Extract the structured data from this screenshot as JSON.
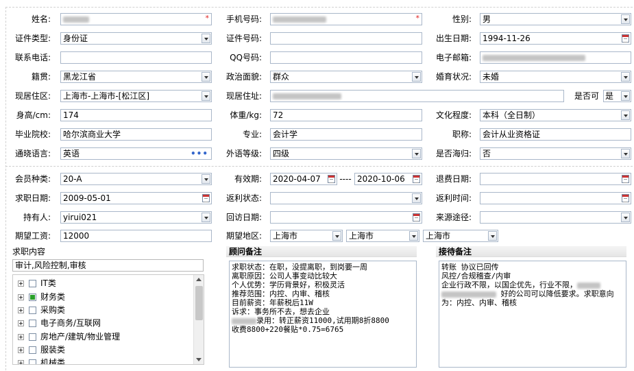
{
  "profile": {
    "name": {
      "label": "姓名:",
      "value": "",
      "required": "*"
    },
    "phone": {
      "label": "手机号码:",
      "value": "",
      "required": "*"
    },
    "gender": {
      "label": "性别:",
      "value": "男"
    },
    "id_type": {
      "label": "证件类型:",
      "value": "身份证"
    },
    "id_number": {
      "label": "证件号码:",
      "value": ""
    },
    "birth_date": {
      "label": "出生日期:",
      "value": "1994-11-26"
    },
    "contact_phone": {
      "label": "联系电话:",
      "value": ""
    },
    "qq": {
      "label": "QQ号码:",
      "value": ""
    },
    "email": {
      "label": "电子邮箱:",
      "value": ""
    },
    "native_place": {
      "label": "籍贯:",
      "value": "黑龙江省"
    },
    "political_status": {
      "label": "政治面貌:",
      "value": "群众"
    },
    "marital_status": {
      "label": "婚育状况:",
      "value": "未婚"
    },
    "current_area": {
      "label": "现居住区:",
      "value": "上海市-上海市-[松江区]"
    },
    "current_address": {
      "label": "现居住址:",
      "value": ""
    },
    "can_label": {
      "label": "是否可",
      "value": "是"
    },
    "height": {
      "label": "身高/cm:",
      "value": "174"
    },
    "weight": {
      "label": "体重/kg:",
      "value": "72"
    },
    "education": {
      "label": "文化程度:",
      "value": "本科（全日制）"
    },
    "school": {
      "label": "毕业院校:",
      "value": "哈尔滨商业大学"
    },
    "major": {
      "label": "专业:",
      "value": "会计学"
    },
    "title": {
      "label": "职称:",
      "value": "会计从业资格证"
    },
    "language": {
      "label": "通晓语言:",
      "value": "英语"
    },
    "foreign_level": {
      "label": "外语等级:",
      "value": "四级"
    },
    "returnee": {
      "label": "是否海归:",
      "value": "否"
    }
  },
  "membership": {
    "member_type": {
      "label": "会员种类:",
      "value": "20-A"
    },
    "validity": {
      "label": "有效期:",
      "start": "2020-04-07",
      "separator": "----",
      "end": "2020-10-06"
    },
    "refund_date": {
      "label": "退费日期:",
      "value": ""
    },
    "job_seek_date": {
      "label": "求职日期:",
      "value": "2009-05-01"
    },
    "rebate_status": {
      "label": "返利状态:",
      "value": ""
    },
    "rebate_time": {
      "label": "返利时间:",
      "value": ""
    },
    "holder": {
      "label": "持有人:",
      "value": "yirui021"
    },
    "revisit_date": {
      "label": "回访日期:",
      "value": ""
    },
    "source": {
      "label": "来源途径:",
      "value": ""
    },
    "expected_salary": {
      "label": "期望工资:",
      "value": "12000"
    },
    "expected_area": {
      "label": "期望地区:",
      "values": [
        "上海市",
        "上海市",
        "上海市"
      ]
    }
  },
  "job_content": {
    "title": "求职内容",
    "value": "审计,风险控制,审核",
    "tree": [
      {
        "label": "IT类",
        "checked": false
      },
      {
        "label": "财务类",
        "checked": true
      },
      {
        "label": "采购类",
        "checked": false
      },
      {
        "label": "电子商务/互联网",
        "checked": false
      },
      {
        "label": "房地产/建筑/物业管理",
        "checked": false
      },
      {
        "label": "服装类",
        "checked": false
      },
      {
        "label": "机械类",
        "checked": false
      }
    ]
  },
  "consultant_notes": {
    "title": "顾问备注",
    "lines": [
      "求职状态：在职，没提离职，到岗要一周",
      "离职原因：公司人事变动比较大",
      "个人优势：学历背景好，积极灵活",
      "推荐范围：内控、内审、稽核",
      "目前薪资：年薪税后11W",
      "诉求：事务所不去，想去企业",
      "录用：转正薪资11000,试用期8折8800",
      "收费8800+220餐贴*0.75=6765"
    ]
  },
  "reception_notes": {
    "title": "接待备注",
    "lines": [
      "转账 协议已回传",
      "风控/合规稽查/内审",
      "企业行政不限，以国企优先，行业不限，",
      "好的公司可以降低要求。求职意向",
      "为：内控、内审、稽核"
    ]
  },
  "icons": {
    "dropdown": "chevron-down-icon",
    "calendar": "calendar-icon",
    "more": "ellipsis-icon",
    "expand": "plus-box-icon",
    "checkbox": "checkbox-icon"
  },
  "colors": {
    "field_border": "#a9b7c9",
    "required": "#e02020",
    "checked": "#2aa02a",
    "accent": "#3366cc"
  }
}
